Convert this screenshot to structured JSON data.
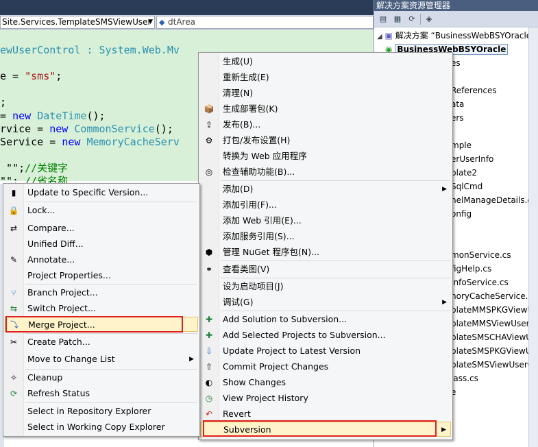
{
  "editor": {
    "nav_class": "Site.Services.TemplateSMSViewUser",
    "nav_member": "dtArea",
    "code_lines": [
      {
        "parts": [
          {
            "t": "ewUserControl : System.Web.Mv",
            "c": "ty"
          }
        ]
      },
      {
        "parts": [
          {
            "t": "e = ",
            "c": ""
          },
          {
            "t": "\"sms\"",
            "c": "str"
          },
          {
            "t": ";",
            "c": ""
          }
        ]
      },
      {
        "parts": [
          {
            "t": ";",
            "c": ""
          }
        ]
      },
      {
        "parts": [
          {
            "t": "= ",
            "c": ""
          },
          {
            "t": "new ",
            "c": "kw"
          },
          {
            "t": "DateTime",
            "c": "ty"
          },
          {
            "t": "();",
            "c": ""
          }
        ]
      },
      {
        "parts": [
          {
            "t": "rvice = ",
            "c": ""
          },
          {
            "t": "new ",
            "c": "kw"
          },
          {
            "t": "CommonService",
            "c": "ty"
          },
          {
            "t": "();",
            "c": ""
          }
        ]
      },
      {
        "parts": [
          {
            "t": "Service = ",
            "c": ""
          },
          {
            "t": "new ",
            "c": "kw"
          },
          {
            "t": "MemoryCacheServ",
            "c": "ty"
          }
        ]
      },
      {
        "parts": [
          {
            "t": " \"\";",
            "c": ""
          },
          {
            "t": "//关键字",
            "c": "cm"
          }
        ]
      },
      {
        "parts": [
          {
            "t": "\"\"; ",
            "c": ""
          },
          {
            "t": "//省名称",
            "c": "cm"
          }
        ]
      }
    ]
  },
  "solution_explorer": {
    "title": "解决方案资源管理器",
    "solution_label": "解决方案 “BusinessWebBSYOracle”",
    "project_label": "BusinessWebBSYOracle",
    "items": [
      "es",
      "References",
      "ata",
      "ers",
      "mple",
      "erUserInfo",
      "plate2",
      "SqlCmd",
      "nelManageDetails.cs",
      "onfig",
      "monService.cs",
      "figHelp.cs",
      "InfoService.cs",
      "noryCacheService.cs",
      "plateMMSPKGViewUs",
      "plateMMSViewUserC",
      "plateSMSCHAViewUs",
      "plateSMSPKGViewUs",
      "plateSMSViewUserCo",
      "lass.cs",
      "e"
    ]
  },
  "main_menu": {
    "items": [
      {
        "label": "生成(U)",
        "icon": ""
      },
      {
        "label": "重新生成(E)",
        "icon": ""
      },
      {
        "label": "清理(N)",
        "icon": ""
      },
      {
        "label": "生成部署包(K)",
        "icon": "package-icon"
      },
      {
        "label": "发布(B)...",
        "icon": "publish-icon"
      },
      {
        "label": "打包/发布设置(H)",
        "icon": "settings-icon"
      },
      {
        "label": "转换为 Web 应用程序",
        "icon": ""
      },
      {
        "label": "检查辅助功能(B)...",
        "icon": "accessibility-icon"
      },
      {
        "label": "添加(D)",
        "icon": "",
        "submenu": true
      },
      {
        "label": "添加引用(F)...",
        "icon": ""
      },
      {
        "label": "添加 Web 引用(E)...",
        "icon": ""
      },
      {
        "label": "添加服务引用(S)...",
        "icon": ""
      },
      {
        "label": "管理 NuGet 程序包(N)...",
        "icon": "nuget-icon"
      },
      {
        "label": "查看类图(V)",
        "icon": "class-diagram-icon"
      },
      {
        "label": "设为启动项目(J)",
        "icon": ""
      },
      {
        "label": "调试(G)",
        "icon": "",
        "submenu": true
      },
      {
        "label": "Add Solution to Subversion...",
        "icon": "svn-add-icon"
      },
      {
        "label": "Add Selected Projects to Subversion...",
        "icon": "svn-add-icon"
      },
      {
        "label": "Update Project to Latest Version",
        "icon": "svn-update-icon"
      },
      {
        "label": "Commit Project Changes",
        "icon": "svn-commit-icon"
      },
      {
        "label": "Show Changes",
        "icon": "svn-changes-icon"
      },
      {
        "label": "View Project History",
        "icon": "svn-history-icon"
      },
      {
        "label": "Revert",
        "icon": "revert-icon"
      },
      {
        "label": "Subversion",
        "icon": "",
        "submenu": true
      }
    ]
  },
  "sub_menu": {
    "items": [
      {
        "label": "Update to Specific Version...",
        "icon": "update-version-icon"
      },
      {
        "label": "Lock...",
        "icon": "lock-icon"
      },
      {
        "label": "Compare...",
        "icon": "compare-icon"
      },
      {
        "label": "Unified Diff...",
        "icon": ""
      },
      {
        "label": "Annotate...",
        "icon": "annotate-icon"
      },
      {
        "label": "Project Properties...",
        "icon": ""
      },
      {
        "label": "Branch Project...",
        "icon": "branch-icon"
      },
      {
        "label": "Switch Project...",
        "icon": "switch-icon"
      },
      {
        "label": "Merge Project...",
        "icon": "merge-icon"
      },
      {
        "label": "Create Patch...",
        "icon": "patch-icon"
      },
      {
        "label": "Move to Change List",
        "icon": "",
        "submenu": true
      },
      {
        "label": "Cleanup",
        "icon": "cleanup-icon"
      },
      {
        "label": "Refresh Status",
        "icon": "refresh-icon"
      },
      {
        "label": "Select in Repository Explorer",
        "icon": ""
      },
      {
        "label": "Select in Working Copy Explorer",
        "icon": ""
      }
    ]
  }
}
